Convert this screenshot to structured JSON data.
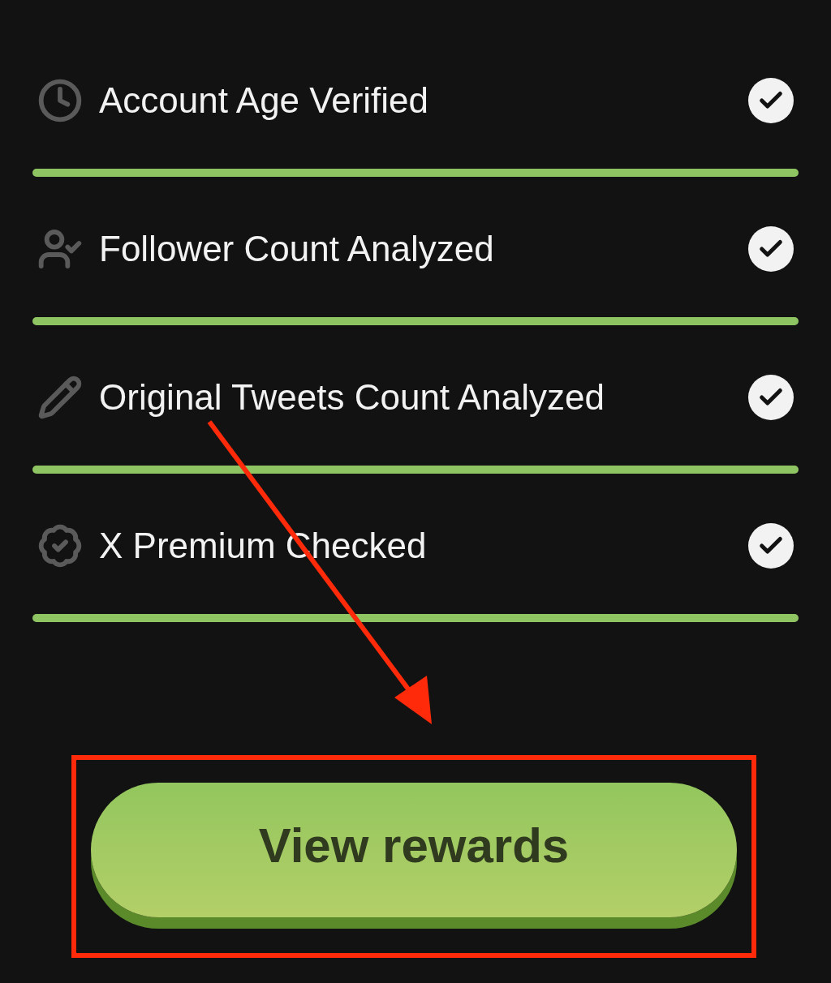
{
  "checks": [
    {
      "label": "Account Age Verified",
      "checked": true,
      "level": 1
    },
    {
      "label": "Follower Count Analyzed",
      "checked": true,
      "level": 1
    },
    {
      "label": "Original Tweets Count Analyzed",
      "checked": true,
      "level": 1
    },
    {
      "label": "X Premium Checked",
      "checked": true,
      "level": 1
    }
  ],
  "button": {
    "label": "View rewards"
  }
}
